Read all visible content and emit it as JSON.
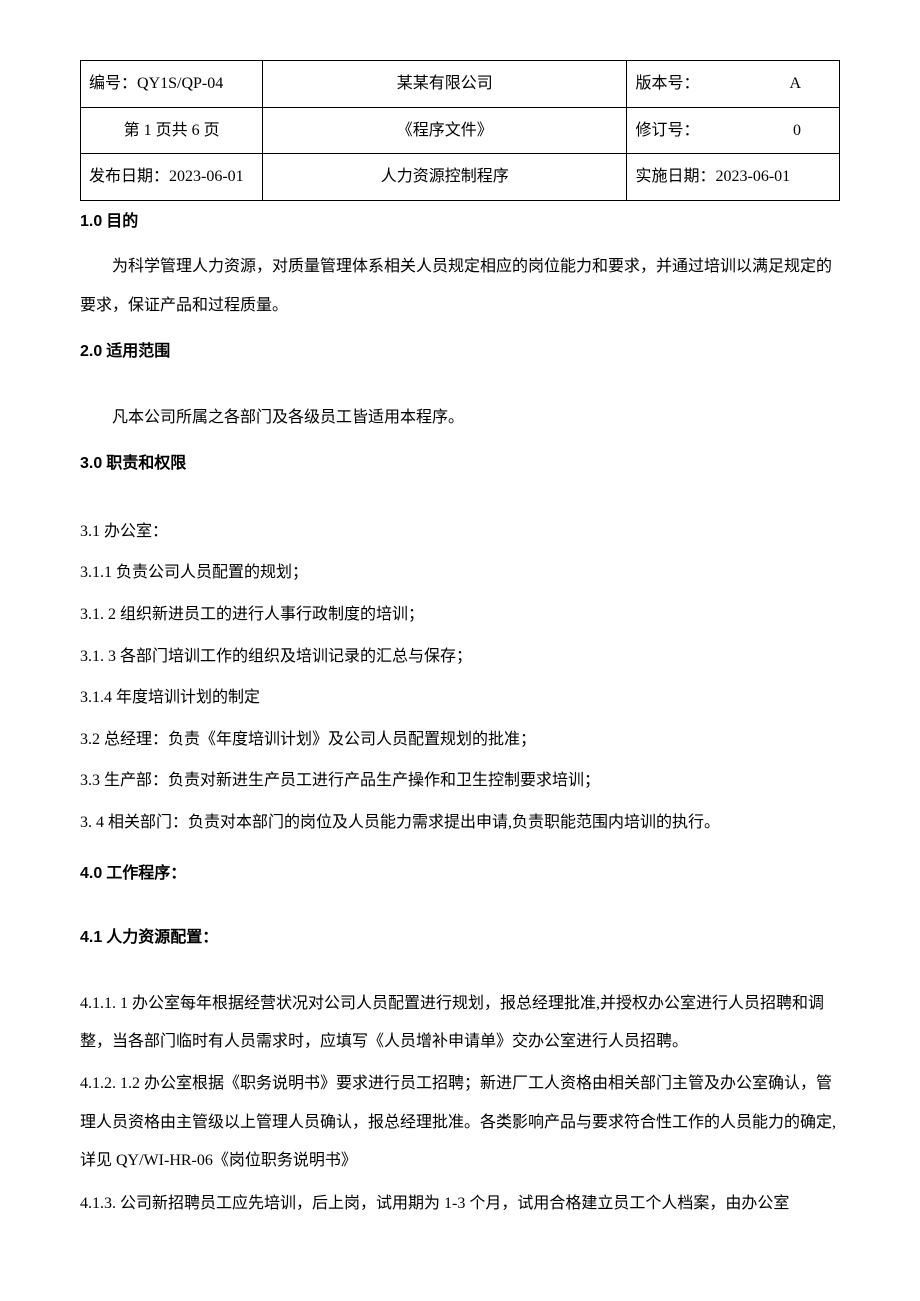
{
  "header": {
    "row1": {
      "doc_no_label": "编号：",
      "doc_no_value": "QY1S/QP-04",
      "company": "某某有限公司",
      "version_label": "版本号：",
      "version_value": "A"
    },
    "row2": {
      "page_info": "第 1 页共 6 页",
      "doc_type": "《程序文件》",
      "revision_label": "修订号：",
      "revision_value": "0"
    },
    "row3": {
      "issue_date_label": "发布日期：",
      "issue_date_value": "2023-06-01",
      "doc_title": "人力资源控制程序",
      "effective_date_label": "实施日期：",
      "effective_date_value": "2023-06-01"
    }
  },
  "s1": {
    "heading_num": "1.0",
    "heading_text": " 目的",
    "body": "为科学管理人力资源，对质量管理体系相关人员规定相应的岗位能力和要求，并通过培训以满足规定的要求，保证产品和过程质量。"
  },
  "s2": {
    "heading_num": "2.0",
    "heading_text": " 适用范围",
    "body": "凡本公司所属之各部门及各级员工皆适用本程序。"
  },
  "s3": {
    "heading_num": "3.0",
    "heading_text": " 职责和权限",
    "i1": "3.1 办公室：",
    "i11": "3.1.1  负责公司人员配置的规划；",
    "i12": "3.1. 2 组织新进员工的进行人事行政制度的培训；",
    "i13": "3.1. 3 各部门培训工作的组织及培训记录的汇总与保存；",
    "i14": "3.1.4 年度培训计划的制定",
    "i2": "3.2 总经理：负责《年度培训计划》及公司人员配置规划的批准；",
    "i3": "3.3 生产部：负责对新进生产员工进行产品生产操作和卫生控制要求培训；",
    "i4": "3. 4 相关部门：负责对本部门的岗位及人员能力需求提出申请,负责职能范围内培训的执行。"
  },
  "s4": {
    "heading_num": "4.0",
    "heading_text": " 工作程序：",
    "sub_heading_num": "4.1",
    "sub_heading_text": "  人力资源配置：",
    "i411": "4.1.1.      1 办公室每年根据经营状况对公司人员配置进行规划，报总经理批准,并授权办公室进行人员招聘和调整，当各部门临时有人员需求时，应填写《人员增补申请单》交办公室进行人员招聘。",
    "i412": "4.1.2.      1.2 办公室根据《职务说明书》要求进行员工招聘；新进厂工人资格由相关部门主管及办公室确认，管理人员资格由主管级以上管理人员确认，报总经理批准。各类影响产品与要求符合性工作的人员能力的确定,详见 QY/WI-HR-06《岗位职务说明书》",
    "i413": "4.1.3.  公司新招聘员工应先培训，后上岗，试用期为 1-3 个月，试用合格建立员工个人档案，由办公室"
  }
}
